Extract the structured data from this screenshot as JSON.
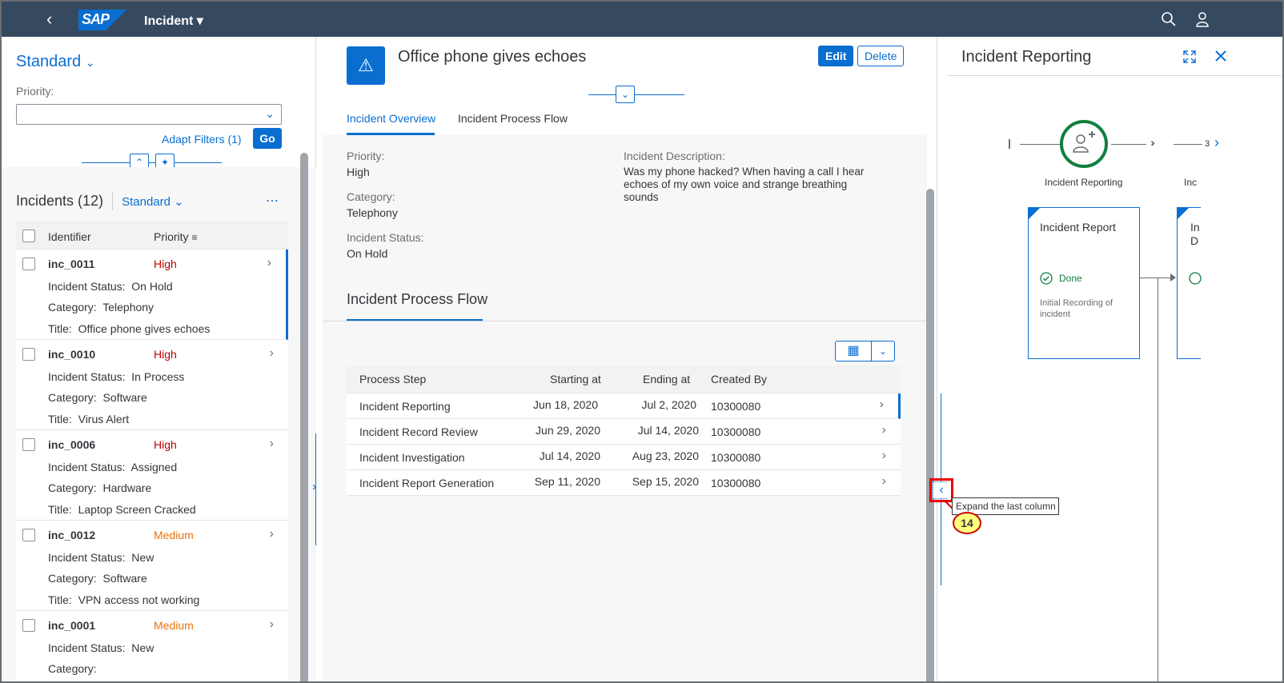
{
  "shell": {
    "title": "Incident"
  },
  "filterbar": {
    "variant": "Standard",
    "priority_label": "Priority:",
    "priority_value": "",
    "adapt_filters": "Adapt Filters (1)",
    "go": "Go"
  },
  "list": {
    "title": "Incidents (12)",
    "variant": "Standard",
    "col_identifier": "Identifier",
    "col_priority": "Priority",
    "rows": [
      {
        "id": "inc_0011",
        "priority": "High",
        "status": "On Hold",
        "category": "Telephony",
        "title": "Office phone gives echoes"
      },
      {
        "id": "inc_0010",
        "priority": "High",
        "status": "In Process",
        "category": "Software",
        "title": "Virus Alert"
      },
      {
        "id": "inc_0006",
        "priority": "High",
        "status": "Assigned",
        "category": "Hardware",
        "title": "Laptop Screen Cracked"
      },
      {
        "id": "inc_0012",
        "priority": "Medium",
        "status": "New",
        "category": "Software",
        "title": "VPN access not working"
      },
      {
        "id": "inc_0001",
        "priority": "Medium",
        "status": "New",
        "category": "",
        "title": ""
      }
    ],
    "lbl_status": "Incident Status:",
    "lbl_category": "Category:",
    "lbl_title": "Title:"
  },
  "detail": {
    "title": "Office phone gives echoes",
    "edit": "Edit",
    "delete": "Delete",
    "tab_overview": "Incident Overview",
    "tab_flow": "Incident Process Flow",
    "priority_label": "Priority:",
    "priority": "High",
    "category_label": "Category:",
    "category": "Telephony",
    "status_label": "Incident Status:",
    "status": "On Hold",
    "desc_label": "Incident Description:",
    "desc": "Was my phone hacked? When having a call I hear echoes of my own voice and strange breathing sounds",
    "section": "Incident Process Flow",
    "table": {
      "headers": [
        "Process Step",
        "Starting at",
        "Ending at",
        "Created By"
      ],
      "rows": [
        [
          "Incident Reporting",
          "Jun 18, 2020",
          "Jul 2, 2020",
          "10300080"
        ],
        [
          "Incident Record Review",
          "Jun 29, 2020",
          "Jul 14, 2020",
          "10300080"
        ],
        [
          "Incident Investigation",
          "Jul 14, 2020",
          "Aug 23, 2020",
          "10300080"
        ],
        [
          "Incident Report Generation",
          "Sep 11, 2020",
          "Sep 15, 2020",
          "10300080"
        ]
      ]
    }
  },
  "flow": {
    "title": "Incident Reporting",
    "lane1": "Incident Reporting",
    "lane2": "Inc",
    "lane_count": "3",
    "node_title": "Incident Report",
    "node_status": "Done",
    "node_desc": "Initial Recording of incident",
    "node2_title_a": "In",
    "node2_title_b": "D"
  },
  "annotation": {
    "tooltip": "Expand the last column",
    "step": "14"
  },
  "colors": {
    "accent": "#0a6ed1",
    "high": "#bb0000",
    "medium": "#e9730c",
    "positive": "#107e3e",
    "shell": "#354a5f"
  }
}
